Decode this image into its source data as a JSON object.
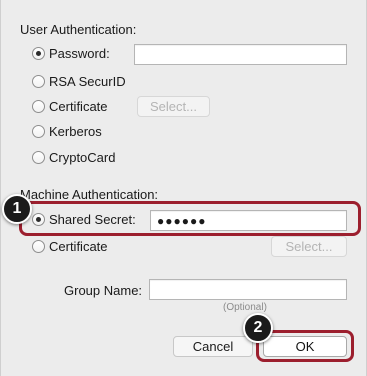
{
  "user_auth": {
    "title": "User Authentication:",
    "options": [
      {
        "label": "Password:",
        "checked": true
      },
      {
        "label": "RSA SecurID",
        "checked": false
      },
      {
        "label": "Certificate",
        "checked": false
      },
      {
        "label": "Kerberos",
        "checked": false
      },
      {
        "label": "CryptoCard",
        "checked": false
      }
    ],
    "password_value": "",
    "certificate_select_label": "Select..."
  },
  "machine_auth": {
    "title": "Machine Authentication:",
    "shared_secret_label": "Shared Secret:",
    "shared_secret_value": "●●●●●●",
    "certificate_label": "Certificate",
    "certificate_select_label": "Select..."
  },
  "group": {
    "label": "Group Name:",
    "value": "",
    "hint": "(Optional)"
  },
  "buttons": {
    "cancel": "Cancel",
    "ok": "OK"
  },
  "callouts": {
    "one": "1",
    "two": "2"
  },
  "colors": {
    "highlight": "#9c1f2e",
    "callout_bg": "#1b1b1b"
  }
}
